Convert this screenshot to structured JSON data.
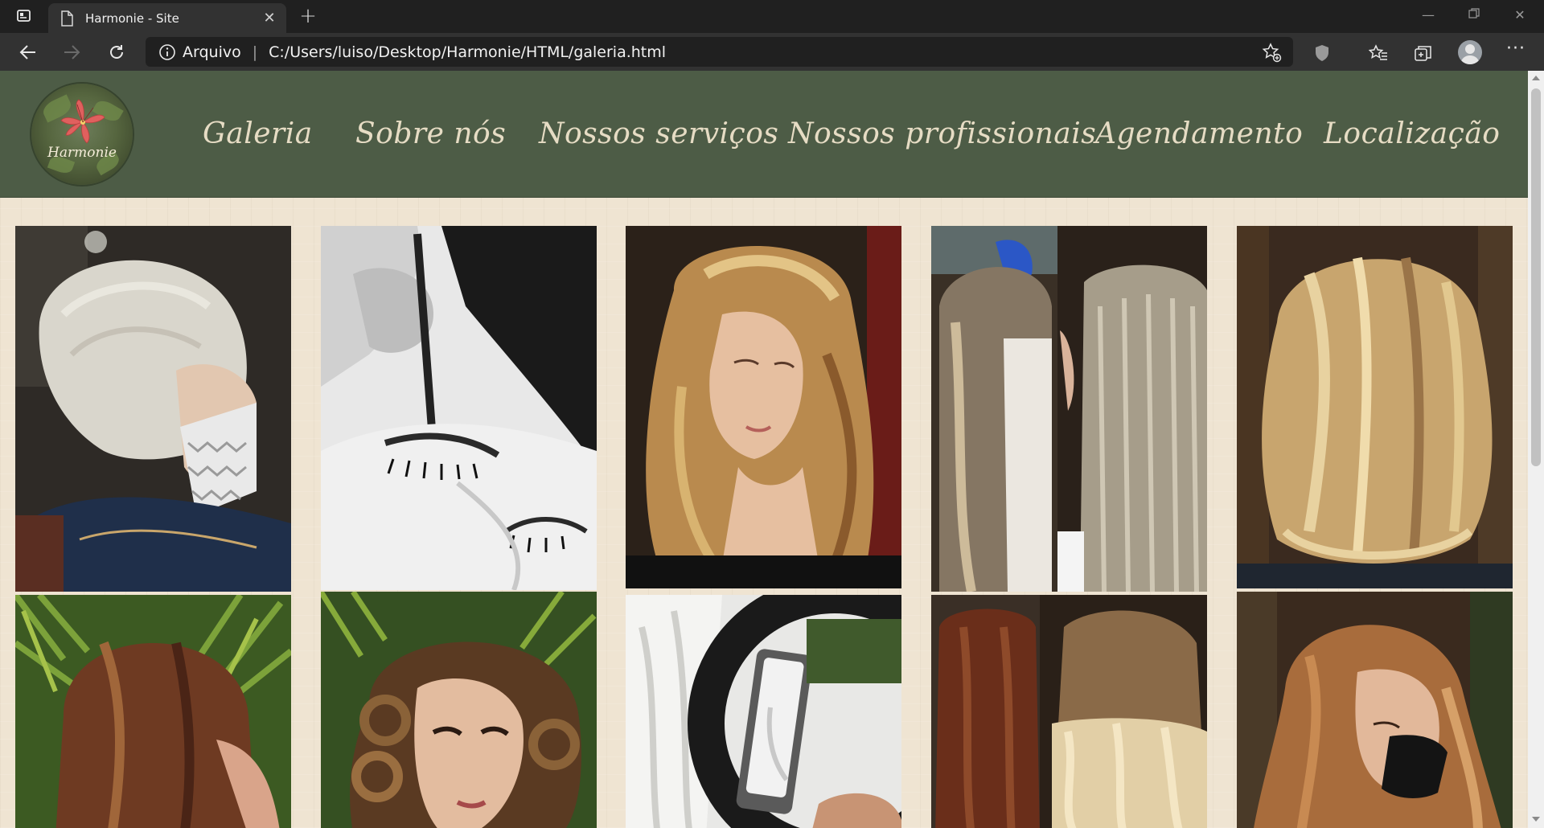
{
  "browser": {
    "tab_title": "Harmonie - Site",
    "address_scheme": "Arquivo",
    "address_separator": "|",
    "url": "C:/Users/luiso/Desktop/Harmonie/HTML/galeria.html"
  },
  "site": {
    "logo_text": "Harmonie",
    "nav": [
      {
        "label": "Galeria"
      },
      {
        "label": "Sobre nós"
      },
      {
        "label": "Nossos serviços"
      },
      {
        "label": "Nossos profissionais"
      },
      {
        "label": "Agendamento"
      },
      {
        "label": "Localização"
      }
    ],
    "colors": {
      "header_bg": "#4d5c46",
      "nav_text": "#e6dcc4",
      "page_bg": "#efe4d2",
      "logo_flower": "#e0605e"
    }
  },
  "gallery": {
    "images": [
      {
        "subject": "woman-short-silver-hair-mask"
      },
      {
        "subject": "eyebrow-tint-black-and-white"
      },
      {
        "subject": "woman-blonde-highlights"
      },
      {
        "subject": "before-after-ash-blonde"
      },
      {
        "subject": "blonde-layered-cut-back-view"
      },
      {
        "subject": "brown-hair-back-view"
      },
      {
        "subject": "woman-brown-curls-makeup"
      },
      {
        "subject": "platinum-hair-ring-light-phone"
      },
      {
        "subject": "before-after-balayage"
      },
      {
        "subject": "woman-caramel-hair-black-mask"
      }
    ]
  }
}
